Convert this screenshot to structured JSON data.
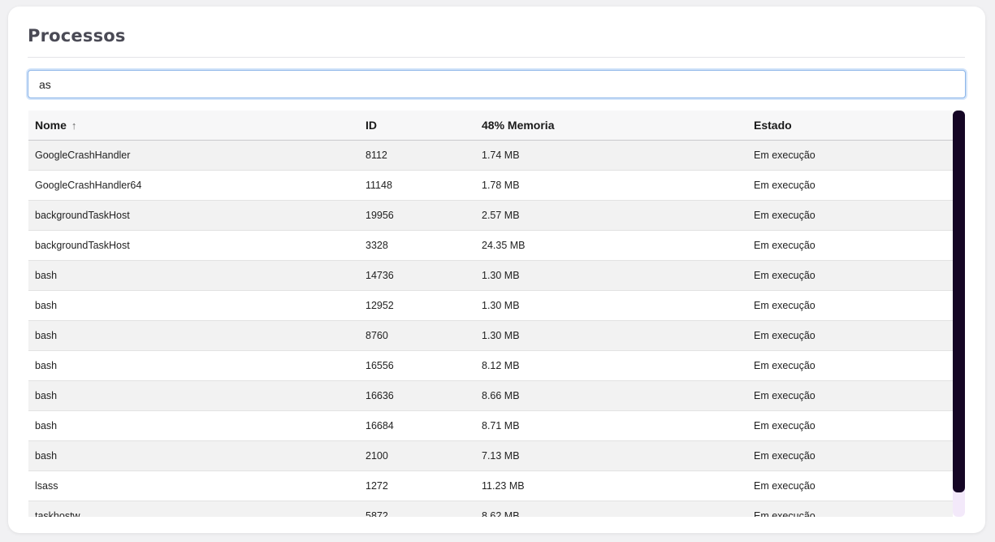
{
  "header": {
    "title": "Processos"
  },
  "search": {
    "value": "as",
    "placeholder": ""
  },
  "table": {
    "columns": [
      "Nome",
      "ID",
      "48% Memoria",
      "Estado"
    ],
    "sort": {
      "column": "Nome",
      "direction": "ascending",
      "icon": "arrow-up-icon"
    },
    "rows": [
      {
        "name": "GoogleCrashHandler",
        "id": "8112",
        "memory": "1.74 MB",
        "state": "Em execução"
      },
      {
        "name": "GoogleCrashHandler64",
        "id": "11148",
        "memory": "1.78 MB",
        "state": "Em execução"
      },
      {
        "name": "backgroundTaskHost",
        "id": "19956",
        "memory": "2.57 MB",
        "state": "Em execução"
      },
      {
        "name": "backgroundTaskHost",
        "id": "3328",
        "memory": "24.35 MB",
        "state": "Em execução"
      },
      {
        "name": "bash",
        "id": "14736",
        "memory": "1.30 MB",
        "state": "Em execução"
      },
      {
        "name": "bash",
        "id": "12952",
        "memory": "1.30 MB",
        "state": "Em execução"
      },
      {
        "name": "bash",
        "id": "8760",
        "memory": "1.30 MB",
        "state": "Em execução"
      },
      {
        "name": "bash",
        "id": "16556",
        "memory": "8.12 MB",
        "state": "Em execução"
      },
      {
        "name": "bash",
        "id": "16636",
        "memory": "8.66 MB",
        "state": "Em execução"
      },
      {
        "name": "bash",
        "id": "16684",
        "memory": "8.71 MB",
        "state": "Em execução"
      },
      {
        "name": "bash",
        "id": "2100",
        "memory": "7.13 MB",
        "state": "Em execução"
      },
      {
        "name": "lsass",
        "id": "1272",
        "memory": "11.23 MB",
        "state": "Em execução"
      },
      {
        "name": "taskhostw",
        "id": "5872",
        "memory": "8.62 MB",
        "state": "Em execução"
      }
    ]
  },
  "colors": {
    "scrollbar_thumb": "#150625",
    "scrollbar_track": "#f3e9fa",
    "focus_ring": "#8ab4e8"
  }
}
